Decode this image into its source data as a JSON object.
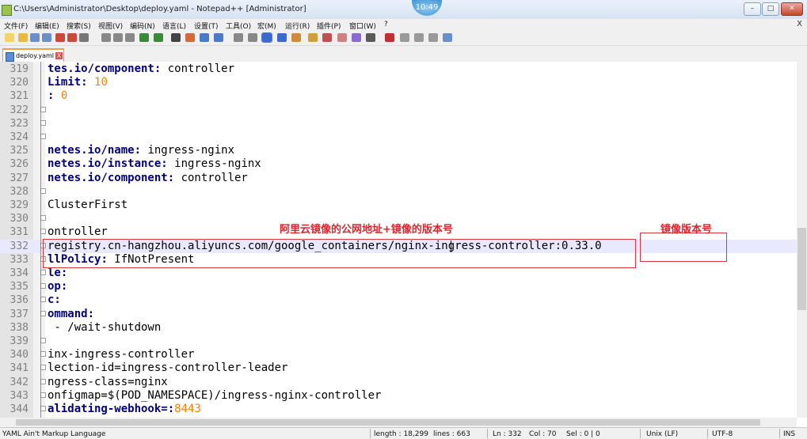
{
  "window": {
    "title": "C:\\Users\\Administrator\\Desktop\\deploy.yaml - Notepad++ [Administrator]",
    "clock": "10:49",
    "minimize_label": "–",
    "maximize_label": "□",
    "close_label": "✕"
  },
  "menu": [
    "文件(F)",
    "编辑(E)",
    "搜索(S)",
    "视图(V)",
    "编码(N)",
    "语言(L)",
    "设置(T)",
    "工具(O)",
    "宏(M)",
    "运行(R)",
    "插件(P)",
    "窗口(W)",
    "?"
  ],
  "menu_close": "X",
  "toolbar_icons": [
    "new-file-icon",
    "open-file-icon",
    "save-icon",
    "save-all-icon",
    "close-icon",
    "close-all-icon",
    "print-icon",
    "cut-icon",
    "copy-icon",
    "paste-icon",
    "undo-icon",
    "redo-icon",
    "find-icon",
    "replace-icon",
    "zoom-in-icon",
    "zoom-out-icon",
    "sync-v-icon",
    "sync-h-icon",
    "wrap-icon",
    "all-chars-icon",
    "indent-guide-icon",
    "udl-icon",
    "map-icon",
    "function-list-icon",
    "folder-workspace-icon",
    "monitor-icon",
    "record-macro-icon",
    "stop-macro-icon",
    "play-macro-icon",
    "play-multi-icon",
    "save-macro-icon"
  ],
  "tab": {
    "label": "deploy.yaml",
    "close": "X"
  },
  "editor": {
    "lines": [
      {
        "num": "319",
        "segs": [
          {
            "t": "tes.io/component",
            "c": "k"
          },
          {
            "t": ": ",
            "c": "k"
          },
          {
            "t": "controller",
            "c": ""
          }
        ]
      },
      {
        "num": "320",
        "segs": [
          {
            "t": "Limit",
            "c": "k"
          },
          {
            "t": ": ",
            "c": "k"
          },
          {
            "t": "10",
            "c": "n"
          }
        ]
      },
      {
        "num": "321",
        "segs": [
          {
            "t": ": ",
            "c": "k"
          },
          {
            "t": "0",
            "c": "n"
          }
        ]
      },
      {
        "num": "322",
        "segs": []
      },
      {
        "num": "323",
        "segs": []
      },
      {
        "num": "324",
        "segs": []
      },
      {
        "num": "325",
        "segs": [
          {
            "t": "netes.io/name",
            "c": "k"
          },
          {
            "t": ": ",
            "c": "k"
          },
          {
            "t": "ingress-nginx",
            "c": ""
          }
        ]
      },
      {
        "num": "326",
        "segs": [
          {
            "t": "netes.io/instance",
            "c": "k"
          },
          {
            "t": ": ",
            "c": "k"
          },
          {
            "t": "ingress-nginx",
            "c": ""
          }
        ]
      },
      {
        "num": "327",
        "segs": [
          {
            "t": "netes.io/component",
            "c": "k"
          },
          {
            "t": ": ",
            "c": "k"
          },
          {
            "t": "controller",
            "c": ""
          }
        ]
      },
      {
        "num": "328",
        "segs": []
      },
      {
        "num": "329",
        "segs": [
          {
            "t": "ClusterFirst",
            "c": ""
          }
        ]
      },
      {
        "num": "330",
        "segs": []
      },
      {
        "num": "331",
        "segs": [
          {
            "t": "ontroller",
            "c": ""
          }
        ]
      },
      {
        "num": "332",
        "segs": [
          {
            "t": "registry.cn-hangzhou.aliyuncs.com/google_containers/nginx-ingress-controller:0.33.0",
            "c": ""
          }
        ]
      },
      {
        "num": "333",
        "segs": [
          {
            "t": "llPolicy",
            "c": "k"
          },
          {
            "t": ": ",
            "c": "k"
          },
          {
            "t": "IfNotPresent",
            "c": ""
          }
        ]
      },
      {
        "num": "334",
        "segs": [
          {
            "t": "le:",
            "c": "k"
          }
        ]
      },
      {
        "num": "335",
        "segs": [
          {
            "t": "op:",
            "c": "k"
          }
        ]
      },
      {
        "num": "336",
        "segs": [
          {
            "t": "c:",
            "c": "k"
          }
        ]
      },
      {
        "num": "337",
        "segs": [
          {
            "t": "ommand:",
            "c": "k"
          }
        ]
      },
      {
        "num": "338",
        "segs": [
          {
            "t": " - /wait-shutdown",
            "c": ""
          }
        ]
      },
      {
        "num": "339",
        "segs": []
      },
      {
        "num": "340",
        "segs": [
          {
            "t": "inx-ingress-controller",
            "c": ""
          }
        ]
      },
      {
        "num": "341",
        "segs": [
          {
            "t": "lection-id=ingress-controller-leader",
            "c": ""
          }
        ]
      },
      {
        "num": "342",
        "segs": [
          {
            "t": "ngress-class=nginx",
            "c": ""
          }
        ]
      },
      {
        "num": "343",
        "segs": [
          {
            "t": "onfigmap=$(POD_NAMESPACE)/ingress-nginx-controller",
            "c": ""
          }
        ]
      },
      {
        "num": "344",
        "segs": [
          {
            "t": "alidating-webhook=",
            "c": "k"
          },
          {
            "t": ":",
            "c": "k"
          },
          {
            "t": "8443",
            "c": "n"
          }
        ]
      }
    ],
    "current_line": "332"
  },
  "annotations": {
    "left_label": "阿里云镜像的公网地址+镜像的版本号",
    "right_label": "镜像版本号",
    "color": "#e0242c"
  },
  "status": {
    "language": "YAML Ain't Markup Language",
    "length": "length : 18,299",
    "lines": "lines : 663",
    "ln": "Ln : 332",
    "col": "Col : 70",
    "sel": "Sel : 0 | 0",
    "eol": "Unix (LF)",
    "encoding": "UTF-8",
    "mode": "INS"
  }
}
